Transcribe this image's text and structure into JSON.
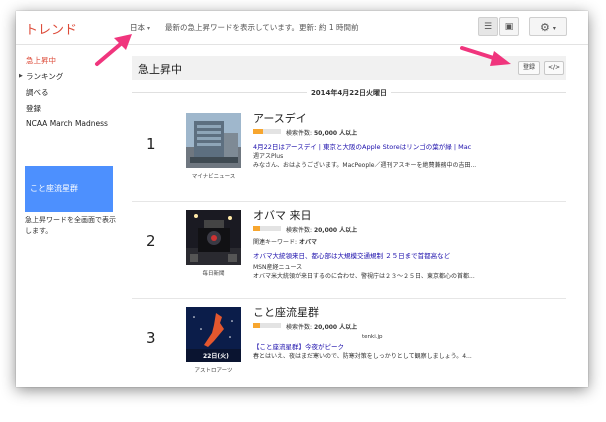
{
  "app": {
    "title": "トレンド"
  },
  "topbar": {
    "region": "日本",
    "status": "最新の急上昇ワードを表示しています。更新: 約 1 時間前"
  },
  "sidebar": {
    "items": [
      {
        "label": "急上昇中",
        "active": true
      },
      {
        "label": "ランキング"
      },
      {
        "label": "調べる"
      },
      {
        "label": "登録"
      },
      {
        "label": "NCAA March Madness"
      }
    ],
    "promo": {
      "label": "こと座流星群",
      "description": "急上昇ワードを全画面で表示します。"
    }
  },
  "section": {
    "title": "急上昇中",
    "register_label": "登録",
    "embed_label": "</>"
  },
  "date": "2014年4月22日火曜日",
  "trends": [
    {
      "rank": "1",
      "keyword": "アースデイ",
      "volume_prefix": "検索件数: ",
      "volume_value": "50,000 人以上",
      "volume_fraction": 0.35,
      "headline": "4月22日はアースデイ | 東京と大阪のApple Storeはリンゴの葉が緑 | Mac",
      "article_source": "週アスPlus",
      "snippet": "みなさん、おはようございます。MacPeople／週刊アスキーを絶賛兼務中の吉田...",
      "image_source": "マイナビニュース"
    },
    {
      "rank": "2",
      "keyword": "オバマ 来日",
      "volume_prefix": "検索件数: ",
      "volume_value": "20,000 人以上",
      "volume_fraction": 0.25,
      "related_label": "関連キーワード: ",
      "related_value": "オバマ",
      "headline": "オバマ大統領来日、都心部は大規模交通規制 ２５日まで首都高など",
      "article_source": "MSN産経ニュース",
      "snippet": "オバマ米大統領が来日するのに合わせ、警視庁は２３～２５日、東京都心の首都...",
      "image_source": "毎日新聞"
    },
    {
      "rank": "3",
      "keyword": "こと座流星群",
      "volume_prefix": "検索件数: ",
      "volume_value": "20,000 人以上",
      "volume_fraction": 0.25,
      "headline": "【こと座流星群】今夜がピーク",
      "article_source": "tenki.jp",
      "snippet": "春とはいえ、夜はまだ寒いので、防寒対策をしっかりとして観察しましょう。4...",
      "image_source": "アストロアーツ",
      "thumb_date": "22日(火)"
    }
  ],
  "colors": {
    "accent": "#dd4b39",
    "link": "#1a0dab",
    "promo": "#4d90fe",
    "bar": "#f7a62f"
  }
}
